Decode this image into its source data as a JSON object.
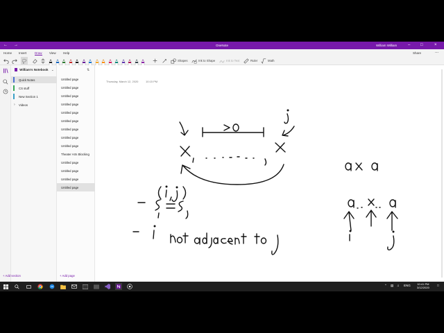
{
  "app": {
    "title": "OneNote",
    "user_name": "William William"
  },
  "ribbon": {
    "menus": [
      "Home",
      "Insert",
      "Draw",
      "View",
      "Help"
    ],
    "active_menu": "Draw",
    "share_label": "Share",
    "more_label": "...",
    "tools": {
      "shapes_label": "Shapes",
      "ink_to_shape_label": "Ink to Shape",
      "ink_to_text_label": "Ink to Text",
      "ruler_label": "Ruler",
      "math_label": "Math"
    },
    "pen_colors": [
      "#222222",
      "#1565c0",
      "#2e7d32",
      "#c62828",
      "#111111",
      "#6a1b9a",
      "#1976d2",
      "#f9a825",
      "#ff8f00",
      "#d81b60",
      "#00897b",
      "#5e35b1",
      "#ad1457",
      "#37474f",
      "#8e24aa"
    ]
  },
  "notebook": {
    "name": "William's Notebook",
    "sections": [
      {
        "label": "Quick Notes",
        "color": "#4a6fd3"
      },
      {
        "label": "CS stuff",
        "color": "#3aa757"
      },
      {
        "label": "New Section 1",
        "color": "#3aa0c7"
      },
      {
        "label": "Videos",
        "color": ""
      }
    ],
    "selected_section": "Quick Notes",
    "add_section_label": "Add section"
  },
  "pages": {
    "items": [
      "Untitled page",
      "Untitled page",
      "Untitled page",
      "Untitled page",
      "Untitled page",
      "Untitled page",
      "Untitled page",
      "Untitled page",
      "Untitled page",
      "Theater Arts Blocking",
      "Untitled page",
      "Untitled page",
      "Untitled page",
      "Untitled page"
    ],
    "selected_index": 13,
    "add_page_label": "Add page"
  },
  "canvas": {
    "page_date": "Thursday, March 12, 2020",
    "page_time": "10:15 PM"
  },
  "taskbar": {
    "language": "ENG",
    "time": "10:41 PM",
    "date": "3/12/2020"
  },
  "colors": {
    "accent": "#7719aa",
    "taskbar": "#1f1f1f"
  }
}
